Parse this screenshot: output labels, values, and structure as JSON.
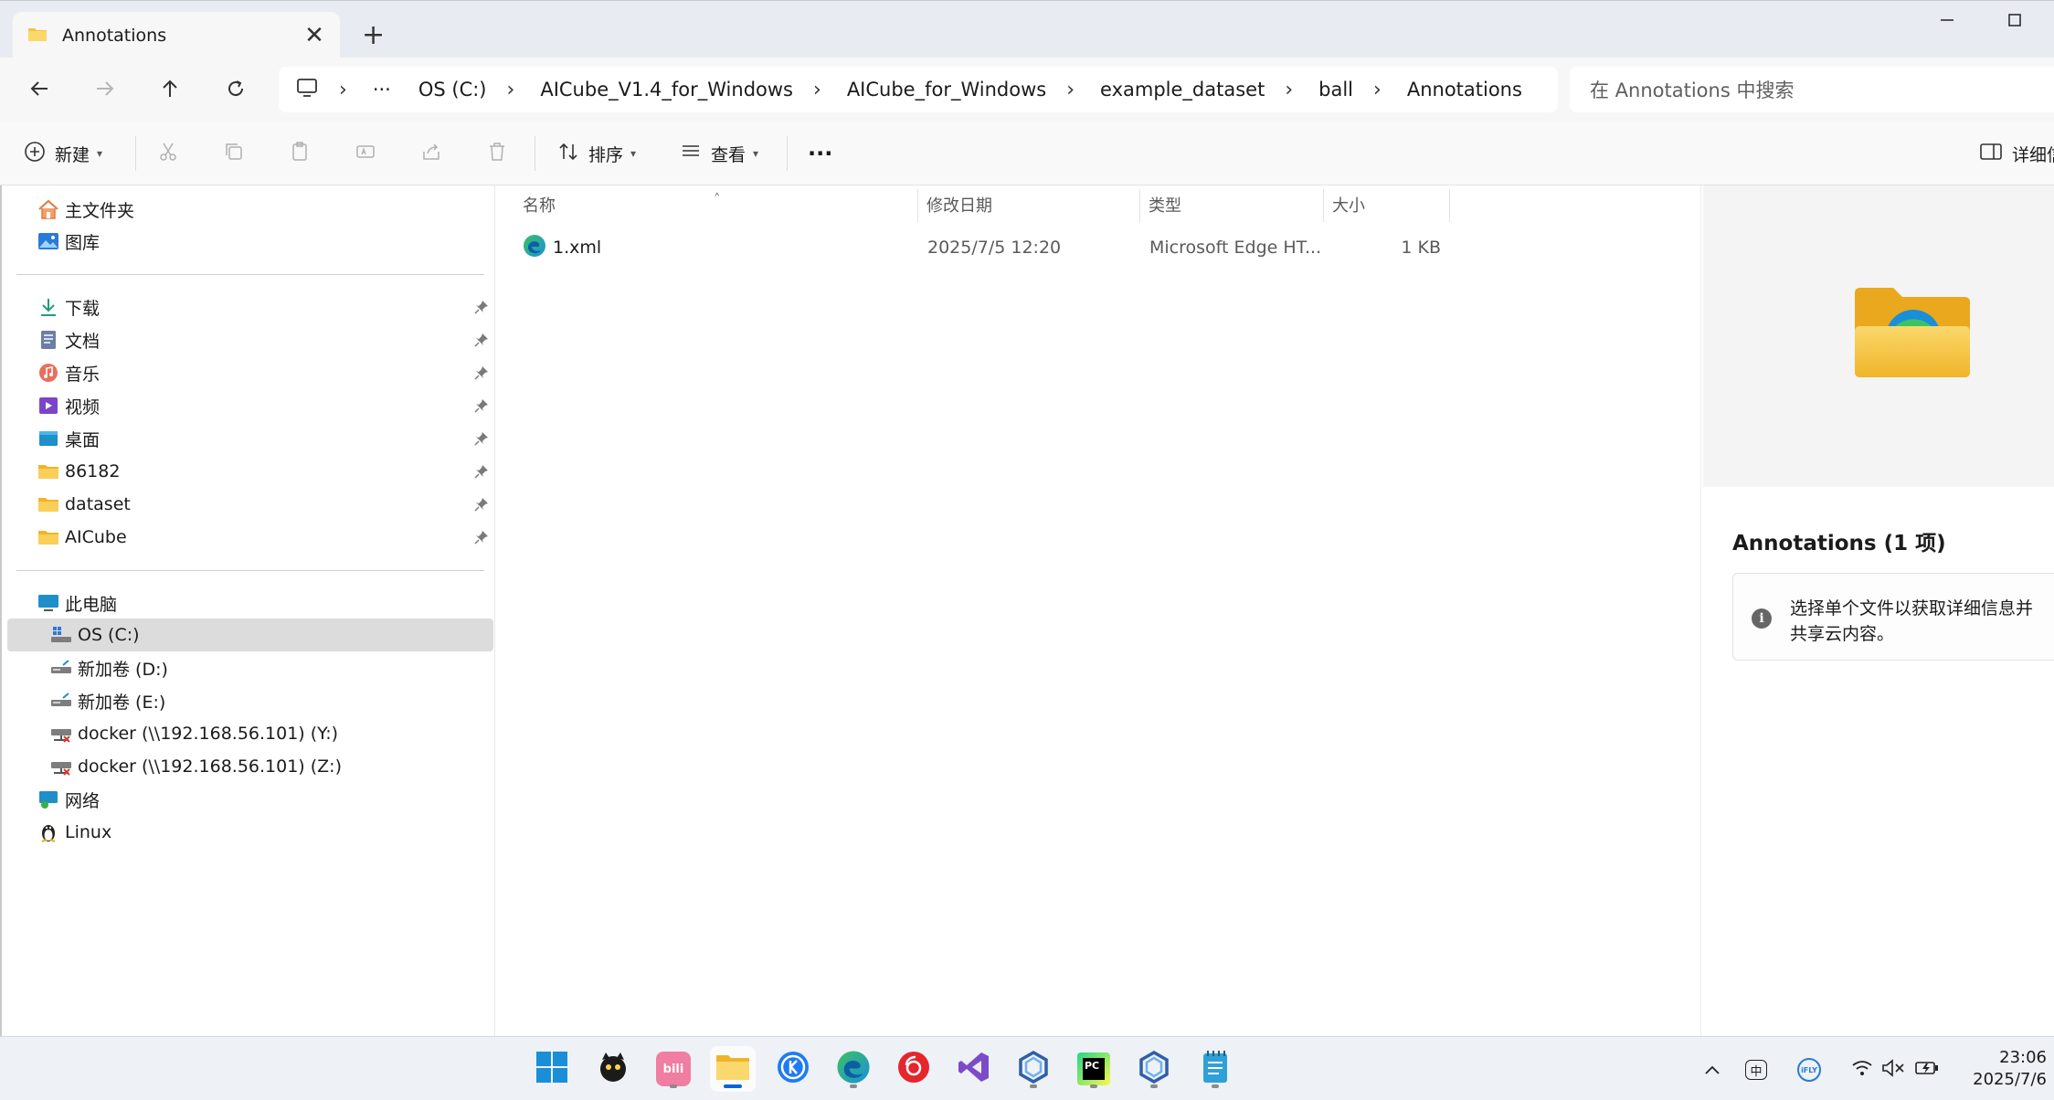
{
  "window": {
    "tab_title": "Annotations",
    "tab_close_icon": "✕",
    "new_tab_icon": "+",
    "minimize_icon": "—",
    "maximize_icon": "☐"
  },
  "address": {
    "more_label": "···",
    "breadcrumbs": [
      "OS (C:)",
      "AICube_V1.4_for_Windows",
      "AICube_for_Windows",
      "example_dataset",
      "ball",
      "Annotations"
    ],
    "separator": "›",
    "search_placeholder": "在 Annotations 中搜索"
  },
  "toolbar": {
    "new_label": "新建",
    "sort_label": "排序",
    "view_label": "查看",
    "more_label": "···",
    "details_label": "详细信息"
  },
  "sidebar": {
    "quick": [
      {
        "label": "主文件夹",
        "icon": "home-icon"
      },
      {
        "label": "图库",
        "icon": "gallery-icon"
      }
    ],
    "pinned": [
      {
        "label": "下载",
        "icon": "download-icon"
      },
      {
        "label": "文档",
        "icon": "document-icon"
      },
      {
        "label": "音乐",
        "icon": "music-icon"
      },
      {
        "label": "视频",
        "icon": "video-icon"
      },
      {
        "label": "桌面",
        "icon": "desktop-icon"
      },
      {
        "label": "86182",
        "icon": "folder-icon"
      },
      {
        "label": "dataset",
        "icon": "folder-icon"
      },
      {
        "label": "AICube",
        "icon": "folder-icon"
      }
    ],
    "this_pc": "此电脑",
    "drives": [
      {
        "label": "OS (C:)",
        "icon": "os-drive-icon",
        "selected": true
      },
      {
        "label": "新加卷 (D:)",
        "icon": "drive-icon"
      },
      {
        "label": "新加卷 (E:)",
        "icon": "drive-icon"
      },
      {
        "label": "docker (\\\\192.168.56.101) (Y:)",
        "icon": "network-drive-icon"
      },
      {
        "label": "docker (\\\\192.168.56.101) (Z:)",
        "icon": "network-drive-icon"
      }
    ],
    "network": "网络",
    "linux": "Linux"
  },
  "filelist": {
    "columns": {
      "name": "名称",
      "modified": "修改日期",
      "type": "类型",
      "size": "大小"
    },
    "sort_indicator": "˄",
    "files": [
      {
        "name": "1.xml",
        "modified": "2025/7/5 12:20",
        "type": "Microsoft Edge HT...",
        "size": "1 KB",
        "icon": "edge-icon"
      }
    ]
  },
  "details": {
    "title": "Annotations (1 项)",
    "info_icon": "i",
    "info_line1": "选择单个文件以获取详细信息并",
    "info_line2": "共享云内容。"
  },
  "taskbar": {
    "apps": [
      "windows-start-icon",
      "desktop-pet-icon",
      "bilibili-icon",
      "file-explorer-icon",
      "kwai-icon",
      "edge-icon",
      "netease-music-icon",
      "visual-studio-icon",
      "aicube-icon",
      "pycharm-icon",
      "aicube-icon-2",
      "notepad-icon"
    ],
    "clock_time": "23:06",
    "clock_date": "2025/7/6",
    "bilibili_label": "bili",
    "pycharm_label": "PC",
    "ime_label": "中",
    "ime2_label": "iFLY"
  },
  "colors": {
    "accent": "#0a64d6",
    "folder_yellow": "#f5c343",
    "edge_blue": "#1a8fd8",
    "edge_green": "#3cc263"
  }
}
